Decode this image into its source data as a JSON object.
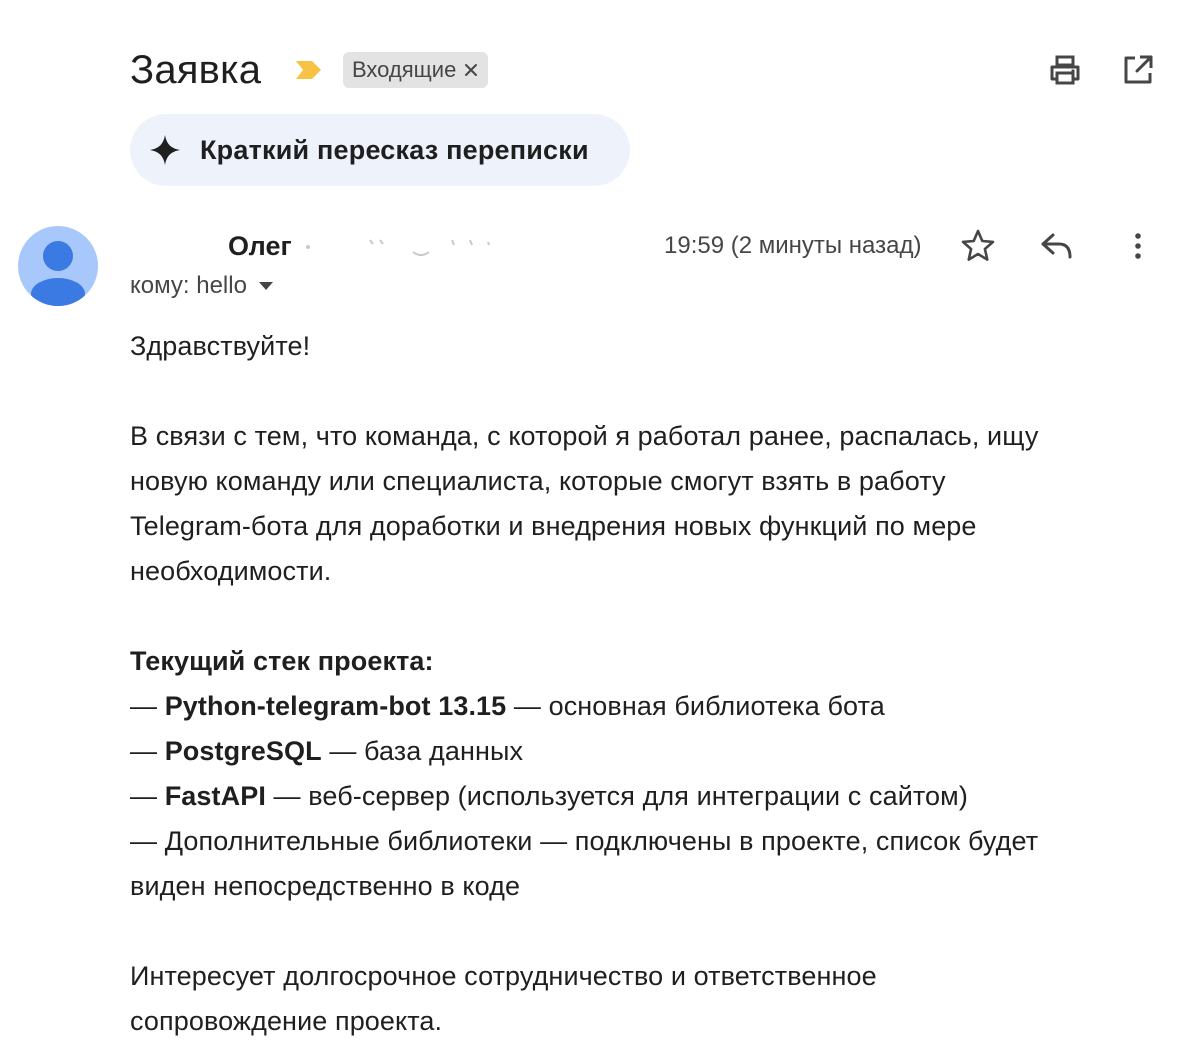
{
  "header": {
    "subject": "Заявка",
    "label": "Входящие"
  },
  "summary": {
    "label": "Краткий пересказ переписки"
  },
  "message": {
    "sender_name": "Олег",
    "time": "19:59 (2 минуты назад)",
    "recipient": "кому: hello"
  },
  "body": {
    "greeting": "Здравствуйте!",
    "intro_lines": [
      "В связи с тем, что команда, с которой я работал ранее, распалась, ищу",
      "новую команду или специалиста, которые смогут взять в работу",
      "Telegram-бота для доработки и внедрения новых функций по мере",
      "необходимости."
    ],
    "stack_heading": "Текущий стек проекта:",
    "stack": [
      {
        "prefix": "— ",
        "name": "Python-telegram-bot 13.15",
        "desc": " — основная библиотека бота"
      },
      {
        "prefix": "— ",
        "name": "PostgreSQL",
        "desc": " — база данных"
      },
      {
        "prefix": "— ",
        "name": "FastAPI",
        "desc": " — веб-сервер (используется для интеграции с сайтом)"
      }
    ],
    "stack_extra_lines": [
      "— Дополнительные библиотеки — подключены в проекте, список будет",
      "виден непосредственно в коде"
    ],
    "closing_lines": [
      "Интересует долгосрочное сотрудничество и ответственное",
      "сопровождение проекта."
    ]
  },
  "icons": {
    "important": "important-marker-icon",
    "chip_close": "close-icon",
    "print": "print-icon",
    "open_new": "open-in-new-window-icon",
    "summary": "sparkle-icon",
    "avatar": "person-icon",
    "star": "star-icon",
    "reply": "reply-icon",
    "more": "more-vert-icon",
    "caret": "chevron-down-icon"
  },
  "colors": {
    "important_marker": "#f6c344",
    "chip_bg": "#e3e3e3",
    "summary_bg": "#eef2fa",
    "avatar_bg": "#a8c7fa",
    "avatar_fg": "#3b79e3",
    "text": "#1f1f1f",
    "secondary_text": "#444746"
  }
}
